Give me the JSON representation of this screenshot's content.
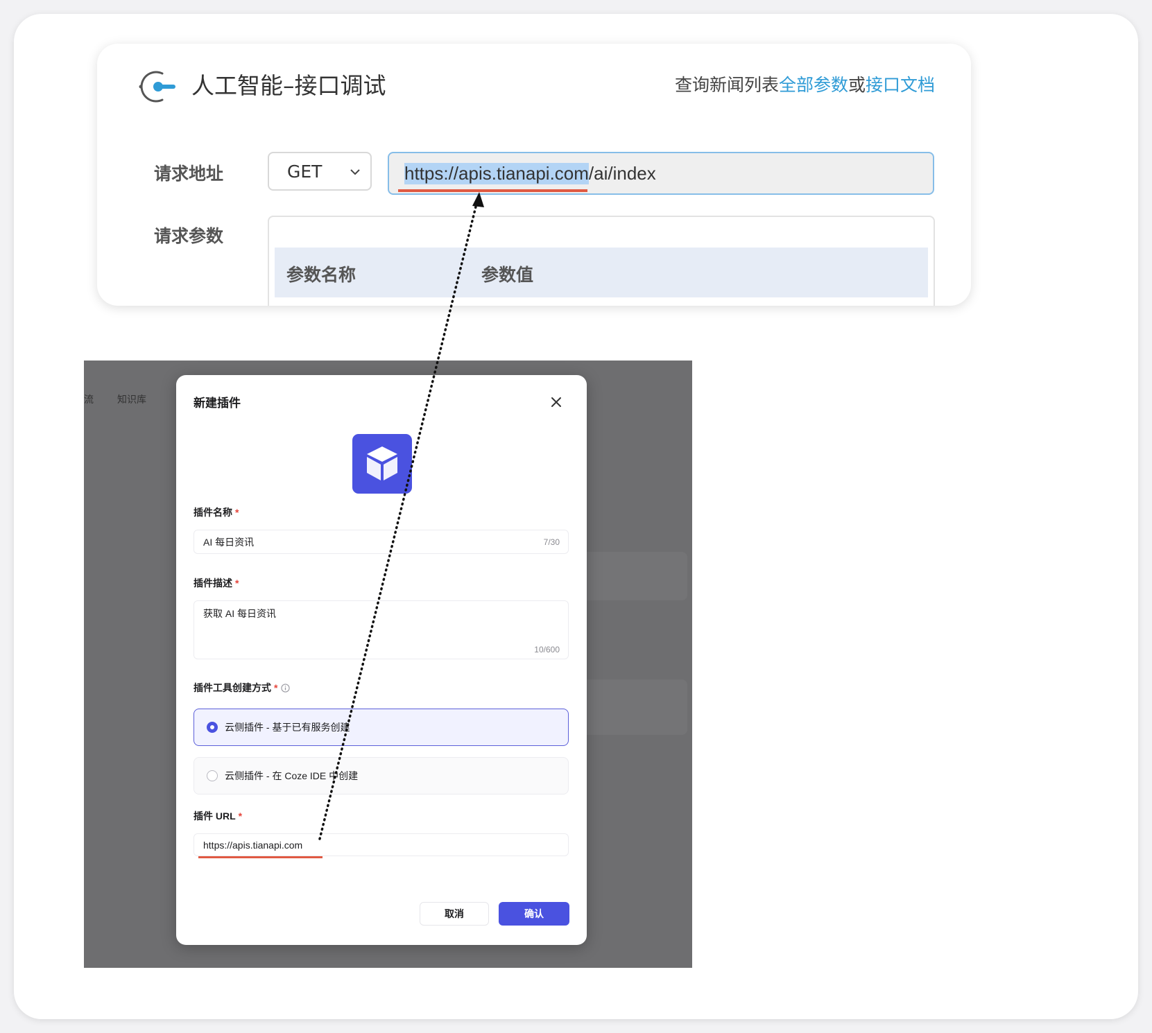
{
  "api_panel": {
    "title": "人工智能–接口调试",
    "links_prefix": "查询新闻列表",
    "link_all_params": "全部参数",
    "links_or": "或",
    "link_api_docs": "接口文档",
    "request_address_label": "请求地址",
    "method": "GET",
    "url_selected_part": "https://apis.tianapi.com",
    "url_rest": "/ai/index",
    "request_params_label": "请求参数",
    "param_name_header": "参数名称",
    "param_value_header": "参数值"
  },
  "coze_background": {
    "nav_items": [
      "流",
      "知识库"
    ]
  },
  "new_plugin_dialog": {
    "title": "新建插件",
    "name_label": "插件名称",
    "name_value": "AI 每日资讯",
    "name_counter": "7/30",
    "desc_label": "插件描述",
    "desc_value": "获取 AI 每日资讯",
    "desc_counter": "10/600",
    "method_label": "插件工具创建方式",
    "options": [
      {
        "label": "云侧插件 - 基于已有服务创建",
        "selected": true
      },
      {
        "label": "云侧插件 - 在 Coze IDE 中创建",
        "selected": false
      }
    ],
    "url_label": "插件 URL",
    "url_value": "https://apis.tianapi.com",
    "required_mark": "*",
    "cancel_label": "取消",
    "confirm_label": "确认"
  },
  "colors": {
    "link_blue": "#2f9bd6",
    "highlight_red": "#e05a43",
    "coze_primary": "#4a52e0",
    "overlay_gray": "#6e6e70"
  }
}
